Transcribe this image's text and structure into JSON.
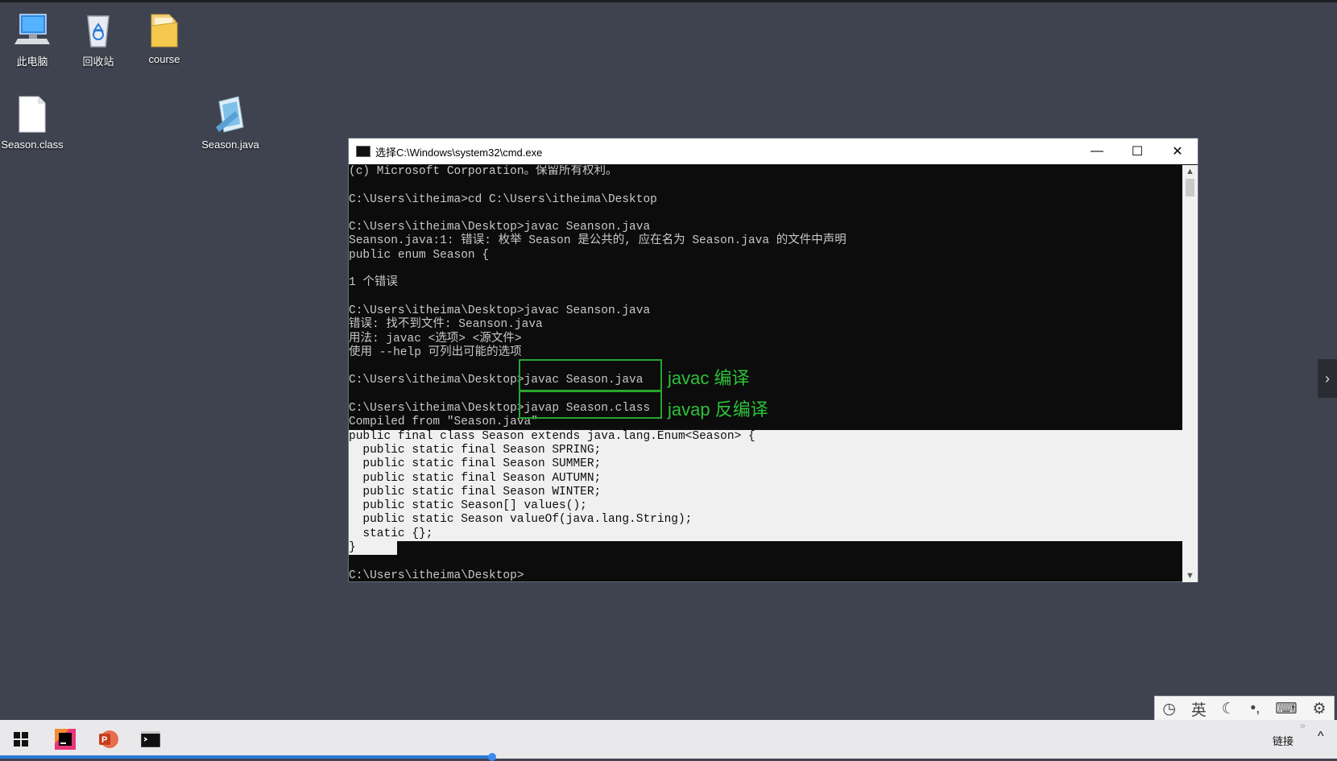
{
  "desktop": {
    "icons": [
      {
        "label": "此电脑",
        "icon": "computer-icon"
      },
      {
        "label": "回收站",
        "icon": "recycle-bin-icon"
      },
      {
        "label": "course",
        "icon": "folder-icon"
      },
      {
        "label": "Season.class",
        "icon": "file-icon"
      },
      {
        "label": "Season.java",
        "icon": "java-file-icon"
      }
    ]
  },
  "cmd_window": {
    "title": "选择C:\\Windows\\system32\\cmd.exe",
    "buttons": {
      "minimize": "—",
      "maximize": "☐",
      "close": "✕"
    },
    "lines": [
      "(c) Microsoft Corporation。保留所有权利。",
      "",
      "C:\\Users\\itheima>cd C:\\Users\\itheima\\Desktop",
      "",
      "C:\\Users\\itheima\\Desktop>javac Seanson.java",
      "Seanson.java:1: 错误: 枚举 Season 是公共的, 应在名为 Season.java 的文件中声明",
      "public enum Season {",
      "",
      "1 个错误",
      "",
      "C:\\Users\\itheima\\Desktop>javac Seanson.java",
      "错误: 找不到文件: Seanson.java",
      "用法: javac <选项> <源文件>",
      "使用 --help 可列出可能的选项",
      "",
      "C:\\Users\\itheima\\Desktop>javac Season.java",
      "",
      "C:\\Users\\itheima\\Desktop>javap Season.class",
      "Compiled from \"Season.java\"",
      "public final class Season extends java.lang.Enum<Season> {",
      "  public static final Season SPRING;",
      "  public static final Season SUMMER;",
      "  public static final Season AUTUMN;",
      "  public static final Season WINTER;",
      "  public static Season[] values();",
      "  public static Season valueOf(java.lang.String);",
      "  static {};",
      "}",
      "",
      "C:\\Users\\itheima\\Desktop>"
    ]
  },
  "annotations": {
    "javac": "javac 编译",
    "javap": "javap 反编译"
  },
  "ime": {
    "items": [
      "◷",
      "英",
      "☾",
      "•,",
      "⌨",
      "⚙"
    ]
  },
  "taskbar": {
    "apps": [
      {
        "name": "start",
        "icon": "windows-start-icon"
      },
      {
        "name": "intellij",
        "icon": "intellij-idea-icon"
      },
      {
        "name": "powerpoint",
        "icon": "powerpoint-icon"
      },
      {
        "name": "cmd",
        "icon": "command-prompt-icon"
      }
    ],
    "tray_link": "链接",
    "tray_chevron": "^"
  },
  "colors": {
    "desktop_bg": "#3f4350",
    "annotation_green": "#2cc238",
    "console_bg": "#0c0c0c",
    "selection_bg": "#f0f0f0"
  }
}
